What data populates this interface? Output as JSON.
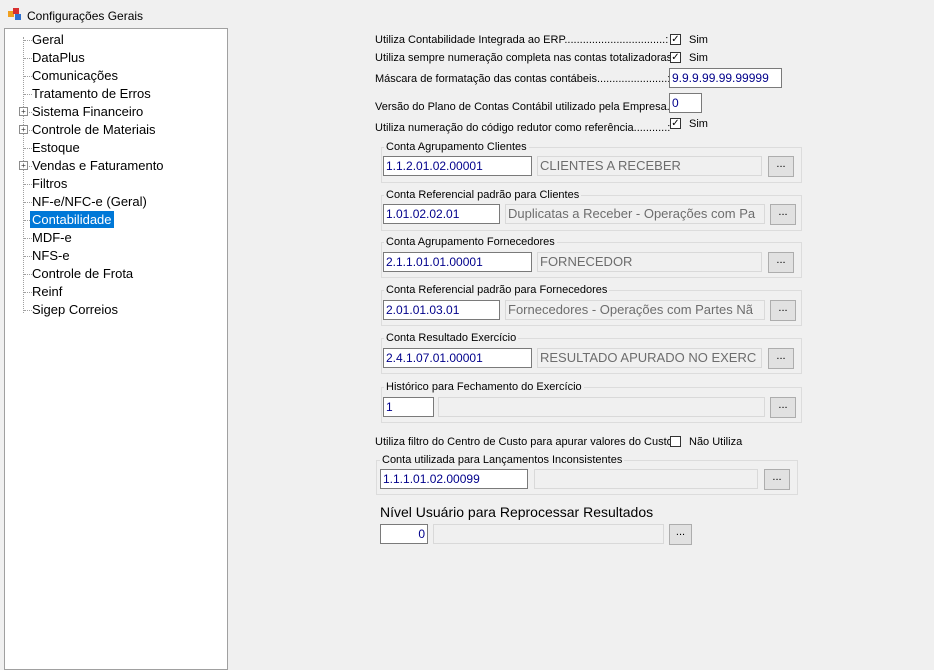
{
  "window": {
    "title": "Configurações Gerais"
  },
  "tree": {
    "items": [
      {
        "label": "Geral",
        "expandable": false
      },
      {
        "label": "DataPlus",
        "expandable": false
      },
      {
        "label": "Comunicações",
        "expandable": false
      },
      {
        "label": "Tratamento de Erros",
        "expandable": false
      },
      {
        "label": "Sistema Financeiro",
        "expandable": true
      },
      {
        "label": "Controle de Materiais",
        "expandable": true
      },
      {
        "label": "Estoque",
        "expandable": false
      },
      {
        "label": "Vendas e Faturamento",
        "expandable": true
      },
      {
        "label": "Filtros",
        "expandable": false
      },
      {
        "label": "NF-e/NFC-e (Geral)",
        "expandable": false
      },
      {
        "label": "Contabilidade",
        "expandable": false,
        "selected": true
      },
      {
        "label": "MDF-e",
        "expandable": false
      },
      {
        "label": "NFS-e",
        "expandable": false
      },
      {
        "label": "Controle de Frota",
        "expandable": false
      },
      {
        "label": "Reinf",
        "expandable": false
      },
      {
        "label": "Sigep Correios",
        "expandable": false
      }
    ]
  },
  "settings": {
    "integrated_label": "Utiliza Contabilidade Integrada ao ERP.................................:",
    "integrated_value": "Sim",
    "full_numbering_label": "Utiliza sempre numeração completa nas contas totalizadoras:",
    "full_numbering_value": "Sim",
    "mask_label": "Máscara de formatação das contas contábeis.......................:",
    "mask_value": "9.9.9.99.99.99999",
    "plan_version_label": "Versão do Plano de Contas Contábil utilizado pela Empresa.:",
    "plan_version_value": "0",
    "reducer_label": "Utiliza numeração do código redutor como referência...........:",
    "reducer_value": "Sim",
    "cost_center_label": "Utiliza filtro do Centro de Custo para apurar valores do Custo:",
    "cost_center_value": "Não Utiliza"
  },
  "groups": {
    "clientes": {
      "title": "Conta Agrupamento Clientes",
      "code": "1.1.2.01.02.00001",
      "description": "CLIENTES A RECEBER"
    },
    "ref_clientes": {
      "title": "Conta Referencial padrão para Clientes",
      "code": "1.01.02.02.01",
      "description": "Duplicatas a Receber - Operações com Pa"
    },
    "fornecedores": {
      "title": "Conta Agrupamento Fornecedores",
      "code": "2.1.1.01.01.00001",
      "description": "FORNECEDOR"
    },
    "ref_fornecedores": {
      "title": "Conta Referencial padrão para Fornecedores",
      "code": "2.01.01.03.01",
      "description": "Fornecedores - Operações com Partes Nã"
    },
    "resultado": {
      "title": "Conta Resultado Exercício",
      "code": "2.4.1.07.01.00001",
      "description": "RESULTADO APURADO NO EXERC"
    },
    "historico": {
      "title": "Histórico para Fechamento do Exercício",
      "code": "1",
      "description": ""
    },
    "inconsistentes": {
      "title": "Conta utilizada para Lançamentos Inconsistentes",
      "code": "1.1.1.01.02.00099",
      "description": ""
    }
  },
  "nivel": {
    "title": "Nível Usuário para Reprocessar Resultados",
    "value": "0",
    "description": ""
  },
  "browse_label": "...",
  "check_mark": "✓",
  "colors": {
    "selection": "#0078d7",
    "input_text": "#00008b",
    "background": "#f0f0f0"
  }
}
